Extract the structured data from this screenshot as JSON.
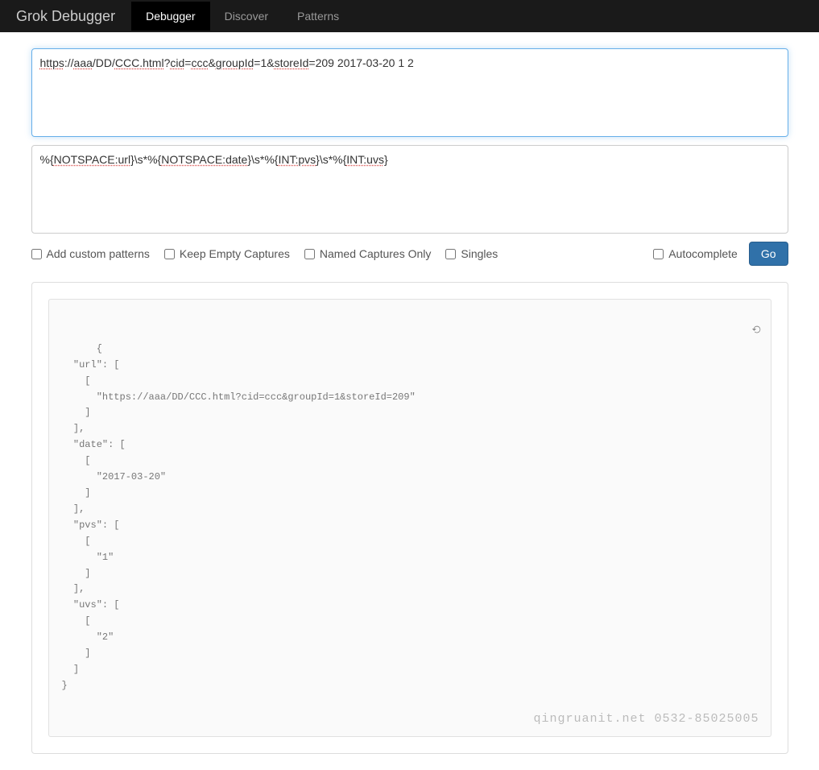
{
  "navbar": {
    "brand": "Grok Debugger",
    "tabs": [
      {
        "label": "Debugger",
        "active": true
      },
      {
        "label": "Discover",
        "active": false
      },
      {
        "label": "Patterns",
        "active": false
      }
    ]
  },
  "input": {
    "segments": [
      {
        "text": "https",
        "err": true
      },
      {
        "text": "://"
      },
      {
        "text": "aaa",
        "err": true
      },
      {
        "text": "/DD/"
      },
      {
        "text": "CCC.html",
        "err": true
      },
      {
        "text": "?"
      },
      {
        "text": "cid",
        "err": true
      },
      {
        "text": "="
      },
      {
        "text": "ccc",
        "err": true
      },
      {
        "text": "&"
      },
      {
        "text": "groupId",
        "err": true
      },
      {
        "text": "=1&"
      },
      {
        "text": "storeId",
        "err": true
      },
      {
        "text": "=209   2017-03-20  1 2"
      }
    ],
    "plain": "https://aaa/DD/CCC.html?cid=ccc&groupId=1&storeId=209   2017-03-20  1 2"
  },
  "pattern": {
    "segments": [
      {
        "text": "%{"
      },
      {
        "text": "NOTSPACE:url",
        "err": true
      },
      {
        "text": "}\\s*%{"
      },
      {
        "text": "NOTSPACE:date",
        "err": true
      },
      {
        "text": "}\\s*%{"
      },
      {
        "text": "INT:pvs",
        "err": true
      },
      {
        "text": "}\\s*%{"
      },
      {
        "text": "INT:uvs",
        "err": true
      },
      {
        "text": "}"
      }
    ],
    "plain": "%{NOTSPACE:url}\\s*%{NOTSPACE:date}\\s*%{INT:pvs}\\s*%{INT:uvs}"
  },
  "options": {
    "add_custom_patterns": "Add custom patterns",
    "keep_empty_captures": "Keep Empty Captures",
    "named_captures_only": "Named Captures Only",
    "singles": "Singles",
    "autocomplete": "Autocomplete",
    "go": "Go"
  },
  "result": {
    "text": "{\n  \"url\": [\n    [\n      \"https://aaa/DD/CCC.html?cid=ccc&groupId=1&storeId=209\"\n    ]\n  ],\n  \"date\": [\n    [\n      \"2017-03-20\"\n    ]\n  ],\n  \"pvs\": [\n    [\n      \"1\"\n    ]\n  ],\n  \"uvs\": [\n    [\n      \"2\"\n    ]\n  ]\n}"
  },
  "watermark": "qingruanit.net 0532-85025005"
}
